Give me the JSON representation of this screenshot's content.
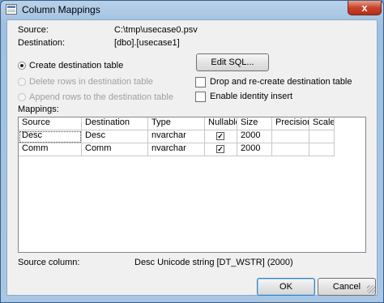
{
  "window": {
    "title": "Column Mappings",
    "close_glyph": "x"
  },
  "info": {
    "source_label": "Source:",
    "source_value": "C:\\tmp\\usecase0.psv",
    "destination_label": "Destination:",
    "destination_value": "[dbo].[usecase1]"
  },
  "options": {
    "create_table": "Create destination table",
    "delete_rows": "Delete rows in destination table",
    "append_rows": "Append rows to the destination table",
    "edit_sql": "Edit SQL...",
    "drop_recreate": "Drop and re-create destination table",
    "enable_identity": "Enable identity insert"
  },
  "mappings": {
    "label": "Mappings:",
    "columns": [
      "Source",
      "Destination",
      "Type",
      "Nullable",
      "Size",
      "Precision",
      "Scale"
    ],
    "rows": [
      {
        "source": "Desc",
        "destination": "Desc",
        "type": "nvarchar",
        "nullable": true,
        "size": "2000",
        "precision": "",
        "scale": ""
      },
      {
        "source": "Comm",
        "destination": "Comm",
        "type": "nvarchar",
        "nullable": true,
        "size": "2000",
        "precision": "",
        "scale": ""
      }
    ]
  },
  "footer": {
    "source_column_label": "Source column:",
    "source_column_value": "Desc Unicode string [DT_WSTR] (2000)",
    "ok": "OK",
    "cancel": "Cancel"
  }
}
